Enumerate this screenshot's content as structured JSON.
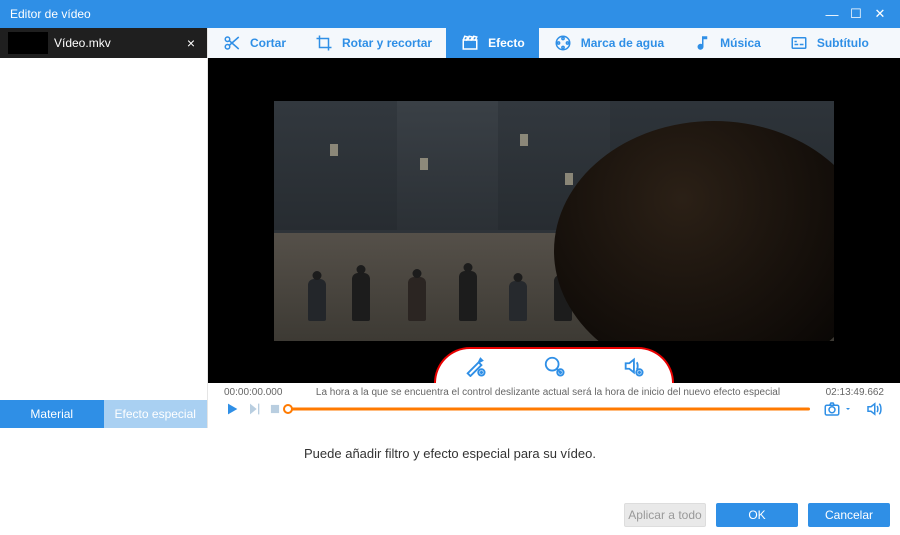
{
  "window": {
    "title": "Editor de vídeo"
  },
  "file": {
    "name": "Vídeo.mkv"
  },
  "toolbar": {
    "cut": "Cortar",
    "rotate": "Rotar y recortar",
    "effect": "Efecto",
    "watermark": "Marca de agua",
    "music": "Música",
    "subtitle": "Subtítulo"
  },
  "sidebar_tabs": {
    "material": "Material",
    "special": "Efecto especial"
  },
  "timeline": {
    "start": "00:00:00.000",
    "hint": "La hora a la que se encuentra el control deslizante actual será la hora de inicio del nuevo efecto especial",
    "end": "02:13:49.662"
  },
  "message": "Puede añadir filtro y efecto especial para su vídeo.",
  "buttons": {
    "apply_all": "Aplicar a todo",
    "ok": "OK",
    "cancel": "Cancelar"
  },
  "colors": {
    "accent": "#2f8fe6",
    "slider": "#ff7a00",
    "highlight_box": "#e80000"
  }
}
